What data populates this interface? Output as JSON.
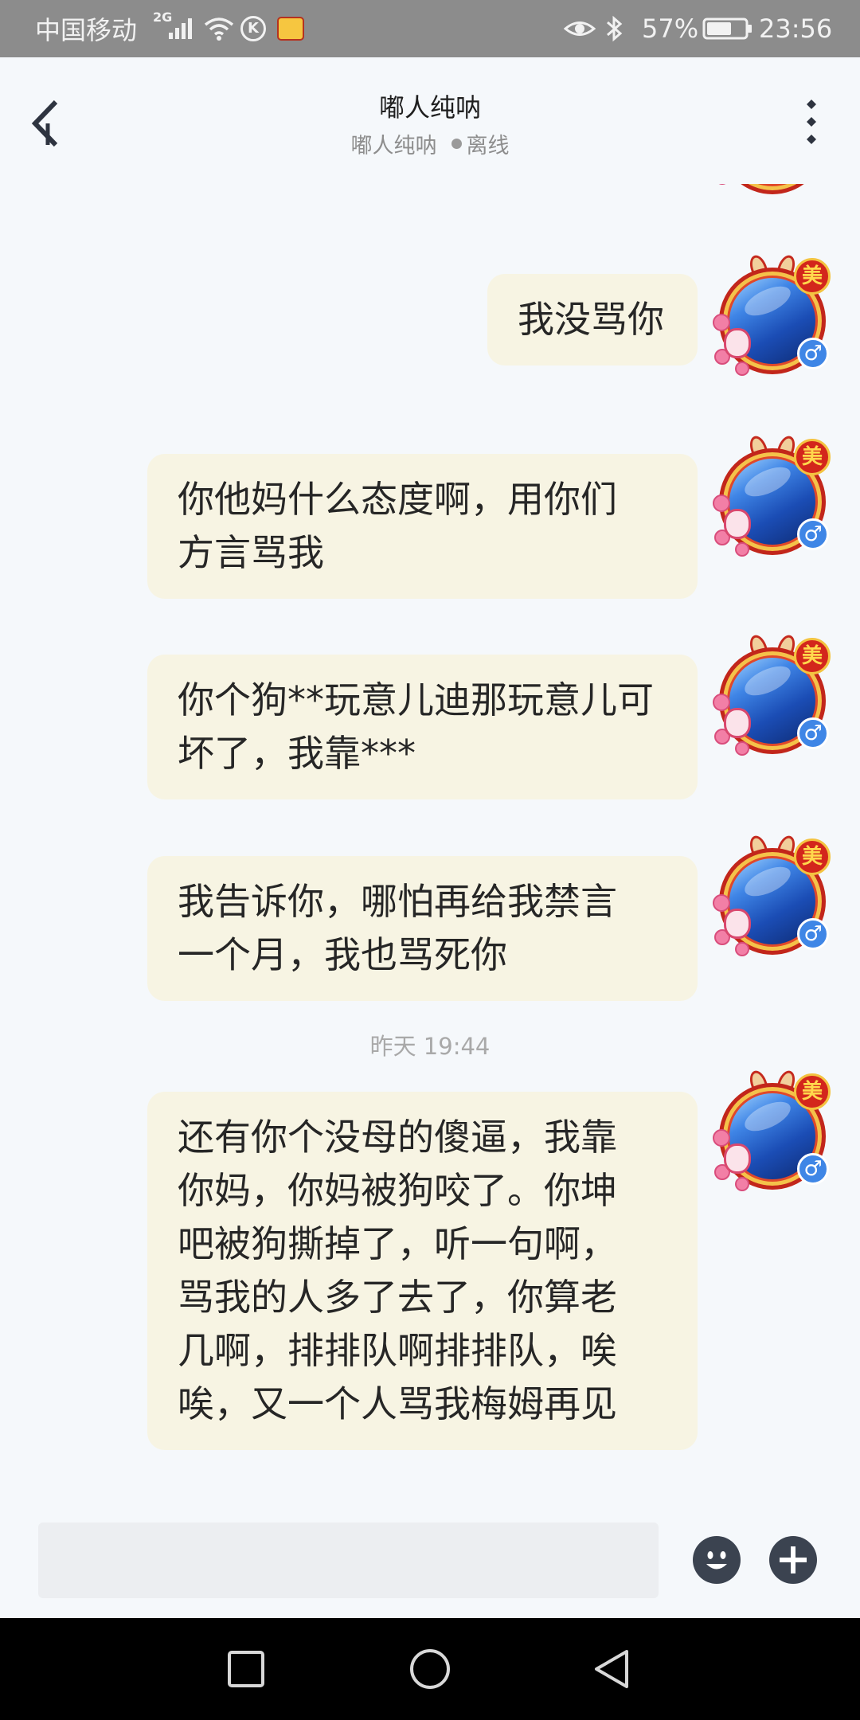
{
  "status_bar": {
    "carrier": "中国移动",
    "network": "2G",
    "app_icon_letter": "K",
    "battery": "57%",
    "time": "23:56",
    "icons": [
      "signal-icon",
      "wifi-icon",
      "k-app-icon",
      "app-notification-icon",
      "eye-icon",
      "bluetooth-icon",
      "battery-icon"
    ]
  },
  "header": {
    "title": "嘟人纯呐",
    "subtitle_name": "嘟人纯呐",
    "status": "离线",
    "icons": [
      "back-arrow-icon",
      "more-vertical-icon"
    ]
  },
  "avatar": {
    "badge": "美",
    "gender_icon": "male-icon"
  },
  "messages": [
    {
      "lines": [
        "我没骂你"
      ]
    },
    {
      "lines": [
        "你他妈什么态度啊，用你们",
        "方言骂我"
      ]
    },
    {
      "lines": [
        "你个狗**玩意儿迪那玩意儿可",
        "坏了，我靠***"
      ]
    },
    {
      "lines": [
        "我告诉你，哪怕再给我禁言",
        "一个月，我也骂死你"
      ]
    },
    {
      "lines": [
        "还有你个没母的傻逼，我靠",
        "你妈，你妈被狗咬了。你坤",
        "吧被狗撕掉了，听一句啊，",
        "骂我的人多了去了，你算老",
        "几啊，排排队啊排排队，唉",
        "唉，又一个人骂我梅姆再见"
      ]
    }
  ],
  "timestamp": "昨天  19:44",
  "input": {
    "value": "",
    "placeholder": ""
  },
  "toolbar_icons": [
    "emoji-icon",
    "plus-icon"
  ],
  "nav_icons": [
    "recents-square-icon",
    "home-circle-icon",
    "back-triangle-icon"
  ],
  "colors": {
    "status_bar": "#8c8c8c",
    "background": "#f5f8fb",
    "bubble": "#f7f4e3",
    "timestamp": "#a9a9a9",
    "action_button": "#3b4350",
    "nav_bar": "#000000"
  }
}
